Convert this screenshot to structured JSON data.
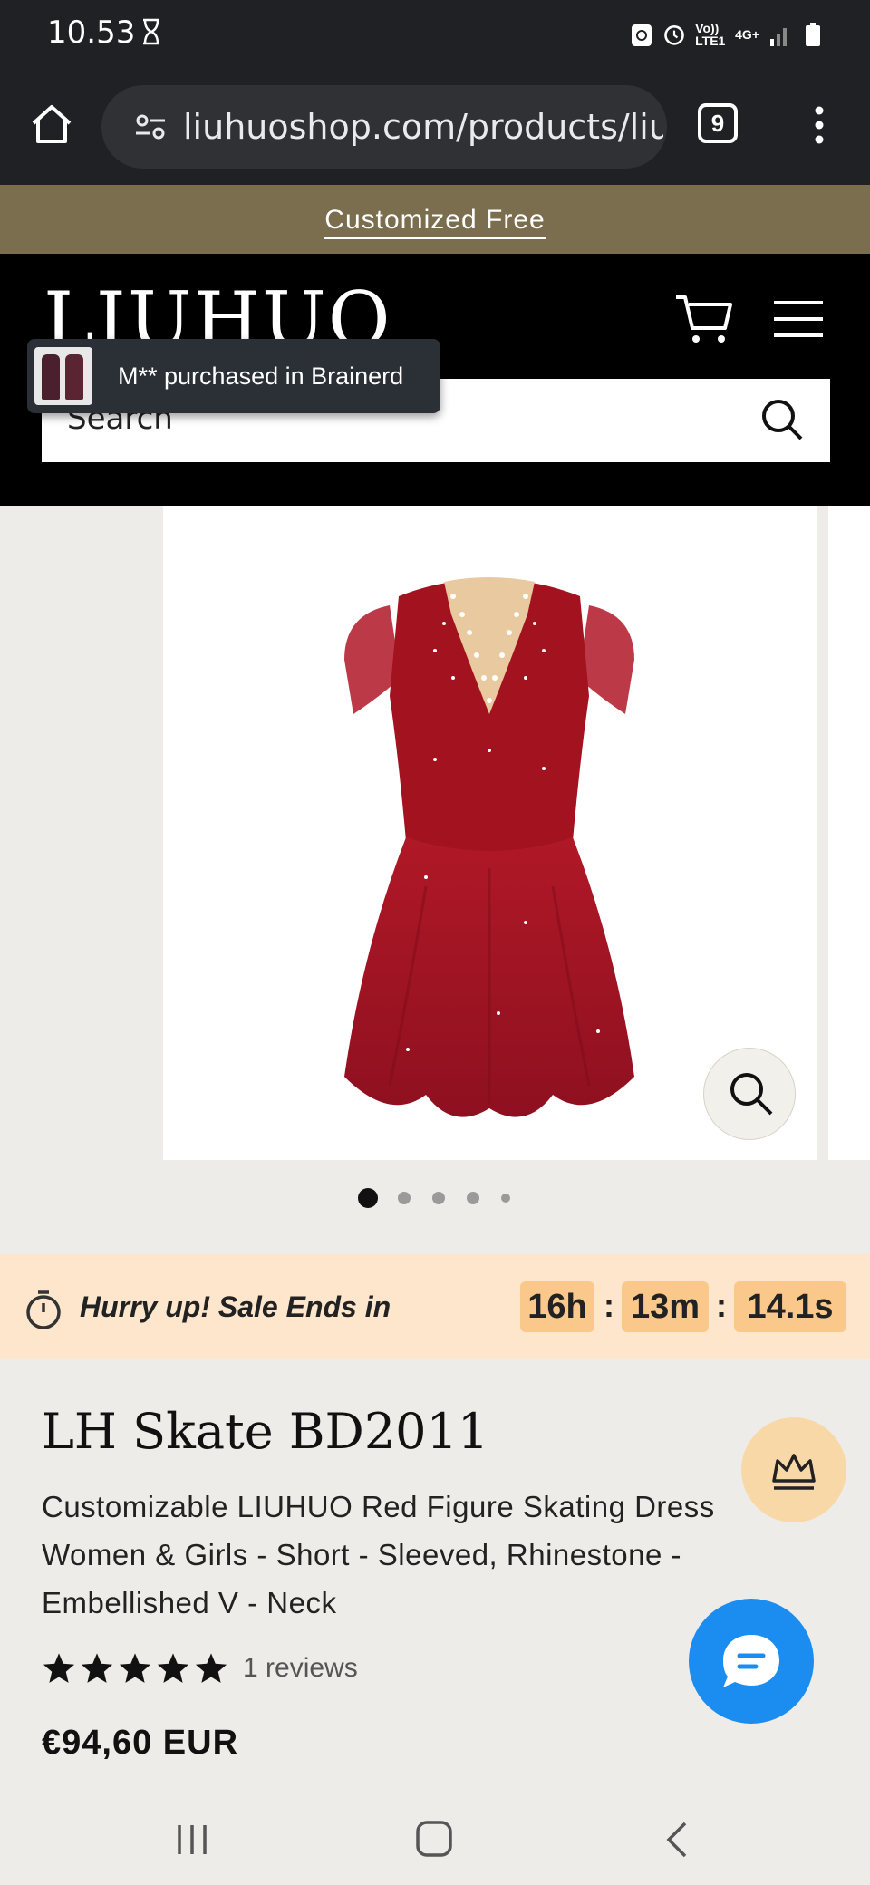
{
  "status_bar": {
    "time": "10.53",
    "icons": [
      "hourglass-icon",
      "recycle-icon",
      "alarm-icon",
      "volte-icon",
      "4g-icon",
      "signal-icon",
      "battery-icon"
    ],
    "network_label": "Vo)) LTE1",
    "network_type": "4G+"
  },
  "browser": {
    "url": "liuhuoshop.com/products/liuh",
    "tab_count": "9"
  },
  "announcement": {
    "text": "Customized Free"
  },
  "header": {
    "logo": "LIUHUO",
    "search_placeholder": "Search"
  },
  "toast": {
    "text": "M** purchased in Brainerd"
  },
  "gallery": {
    "dot_count": 5,
    "active_index": 0
  },
  "sale": {
    "label": "Hurry up! Sale Ends in",
    "hours": "16h",
    "minutes": "13m",
    "seconds": "14.1s",
    "separator": ":"
  },
  "product": {
    "title": "LH Skate BD2011",
    "description": "Customizable LIUHUO Red Figure Skating Dress Women & Girls - Short - Sleeved, Rhinestone - Embellished V - Neck",
    "rating": 5,
    "reviews": "1 reviews",
    "price": "€94,60 EUR"
  },
  "colors": {
    "announcement_bg": "#7a6e4e",
    "sale_bg": "#fde6cc",
    "countdown_bg": "#f9c88a",
    "chat_blue": "#1b8cf0",
    "dress_red": "#a0141f"
  }
}
